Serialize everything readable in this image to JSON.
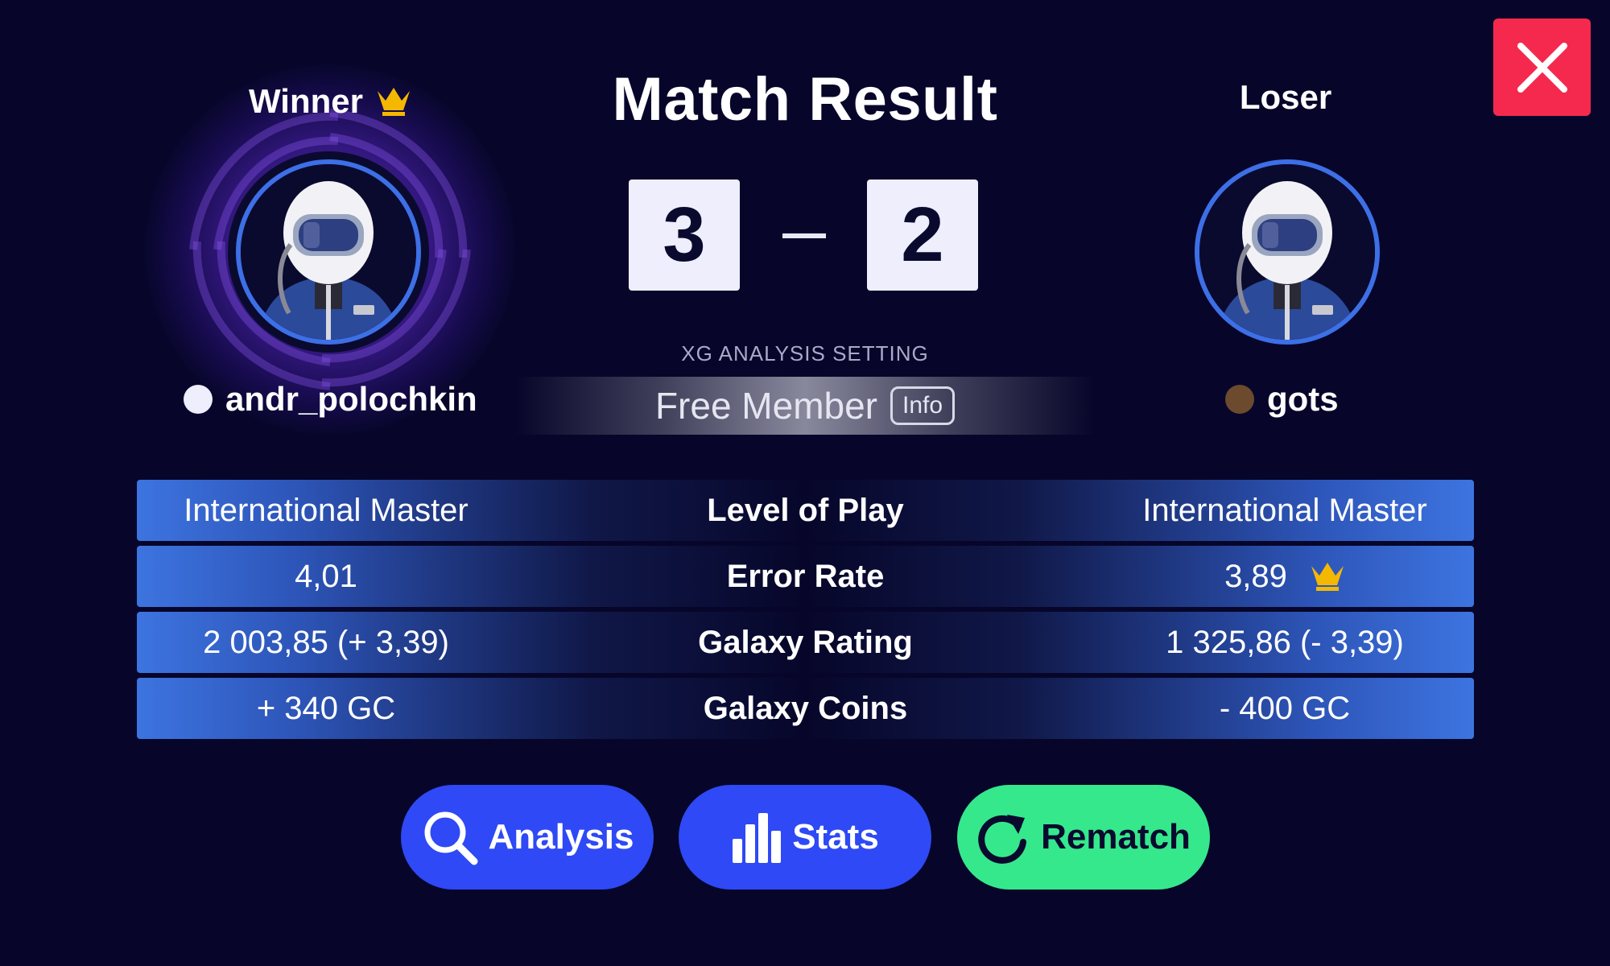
{
  "header": {
    "title": "Match Result",
    "close_icon": "close-icon"
  },
  "winner": {
    "role_label": "Winner",
    "role_icon": "crown-icon",
    "name": "andr_polochkin",
    "color_dot": "#eeeefc",
    "avatar_icon": "astronaut-avatar-icon",
    "score": "3"
  },
  "loser": {
    "role_label": "Loser",
    "name": "gots",
    "color_dot": "#6b4a2e",
    "avatar_icon": "astronaut-avatar-icon",
    "score": "2"
  },
  "analysis_setting": {
    "label": "XG ANALYSIS SETTING",
    "value": "Free Member",
    "info_label": "Info"
  },
  "stats": [
    {
      "label": "Level of Play",
      "left": "International Master",
      "right": "International Master",
      "best": ""
    },
    {
      "label": "Error Rate",
      "left": "4,01",
      "right": "3,89",
      "best": "right"
    },
    {
      "label": "Galaxy Rating",
      "left": "2 003,85 (+ 3,39)",
      "right": "1 325,86 (- 3,39)",
      "best": ""
    },
    {
      "label": "Galaxy Coins",
      "left": "+ 340 GC",
      "right": "- 400 GC",
      "best": ""
    }
  ],
  "actions": {
    "analysis": {
      "label": "Analysis",
      "icon": "search-icon"
    },
    "stats": {
      "label": "Stats",
      "icon": "bar-chart-icon"
    },
    "rematch": {
      "label": "Rematch",
      "icon": "refresh-icon"
    }
  },
  "colors": {
    "background": "#07062a",
    "accent_blue": "#2e49f5",
    "accent_green": "#35e88c",
    "close_red": "#f5294e",
    "crown_gold": "#f5b800",
    "ring_blue": "#3d6fe6"
  }
}
